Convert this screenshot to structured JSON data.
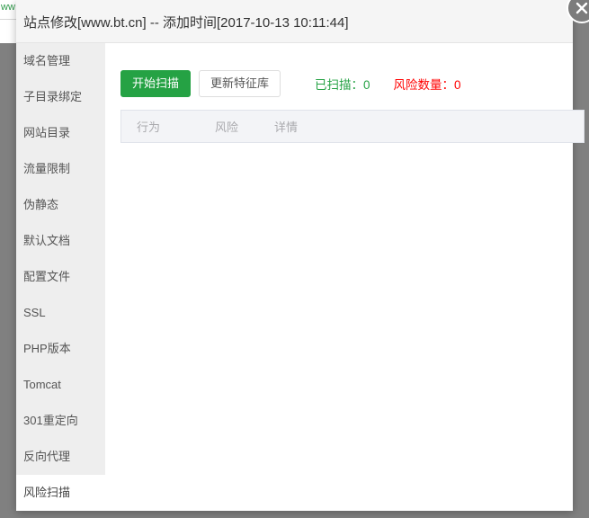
{
  "background": {
    "fragment_text": "ww"
  },
  "modal": {
    "title": "站点修改[www.bt.cn] -- 添加时间[2017-10-13 10:11:44]",
    "close_icon": "close-icon"
  },
  "sidebar": {
    "items": [
      {
        "label": "域名管理",
        "active": false
      },
      {
        "label": "子目录绑定",
        "active": false
      },
      {
        "label": "网站目录",
        "active": false
      },
      {
        "label": "流量限制",
        "active": false
      },
      {
        "label": "伪静态",
        "active": false
      },
      {
        "label": "默认文档",
        "active": false
      },
      {
        "label": "配置文件",
        "active": false
      },
      {
        "label": "SSL",
        "active": false
      },
      {
        "label": "PHP版本",
        "active": false
      },
      {
        "label": "Tomcat",
        "active": false
      },
      {
        "label": "301重定向",
        "active": false
      },
      {
        "label": "反向代理",
        "active": false
      },
      {
        "label": "风险扫描",
        "active": true
      }
    ]
  },
  "toolbar": {
    "start_scan_label": "开始扫描",
    "update_signatures_label": "更新特征库",
    "scanned_label": "已扫描：0",
    "risk_count_label": "风险数量：0"
  },
  "results_table": {
    "columns": [
      "行为",
      "风险",
      "详情"
    ],
    "rows": []
  },
  "colors": {
    "accent_green": "#25a244",
    "risk_red": "#ff0000",
    "sidebar_bg": "#eeeeee",
    "titlebar_bg": "#f5f5f5",
    "table_head_bg": "#f3f4f7",
    "backdrop": "#808080"
  }
}
